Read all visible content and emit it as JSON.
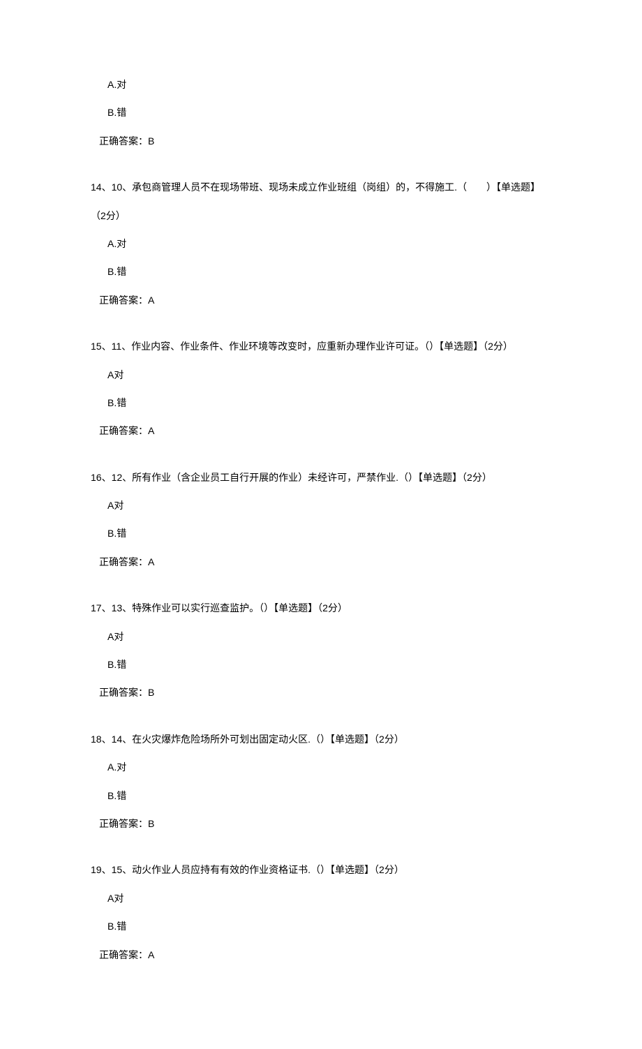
{
  "q13": {
    "option_a": "A.对",
    "option_b": "B.错",
    "answer": "正确答案：B"
  },
  "q14": {
    "question": "14、10、承包商管理人员不在现场带班、现场未成立作业班组（岗组）的，不得施工.（　　）【单选题】",
    "points": "（2分）",
    "option_a": "A.对",
    "option_b": "B.错",
    "answer": "正确答案：A"
  },
  "q15": {
    "question": "15、11、作业内容、作业条件、作业环境等改变时，应重新办理作业许可证。（）【单选题】（2分）",
    "option_a": "A对",
    "option_b": "B.错",
    "answer": "正确答案：A"
  },
  "q16": {
    "question": "16、12、所有作业（含企业员工自行开展的作业）未经许可，严禁作业.（）【单选题】（2分）",
    "option_a": "A对",
    "option_b": "B.错",
    "answer": "正确答案：A"
  },
  "q17": {
    "question": "17、13、特殊作业可以实行巡查监护。（）【单选题】（2分）",
    "option_a": "A对",
    "option_b": "B.错",
    "answer": "正确答案：B"
  },
  "q18": {
    "question": "18、14、在火灾爆炸危险场所外可划出固定动火区.（）【单选题】（2分）",
    "option_a": "A.对",
    "option_b": "B.错",
    "answer": "正确答案：B"
  },
  "q19": {
    "question": "19、15、动火作业人员应持有有效的作业资格证书.（）【单选题】（2分）",
    "option_a": "A对",
    "option_b": "B.错",
    "answer": "正确答案：A"
  }
}
